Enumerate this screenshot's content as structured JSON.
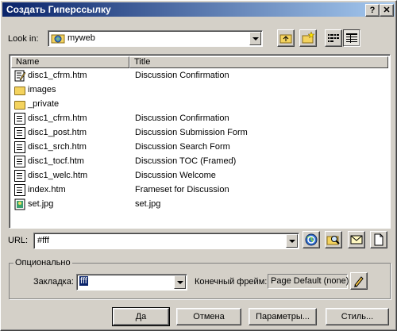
{
  "window": {
    "title": "Создать Гиперссылку",
    "help_btn": "?",
    "close_btn": "✕"
  },
  "lookin": {
    "label": "Look in:",
    "value": "myweb"
  },
  "columns": {
    "name": "Name",
    "title": "Title"
  },
  "files": [
    {
      "name": "disc1_cfrm.htm",
      "title": "Discussion Confirmation",
      "icon": "html-edit-icon"
    },
    {
      "name": "images",
      "title": "",
      "icon": "folder-icon"
    },
    {
      "name": "_private",
      "title": "",
      "icon": "folder-icon"
    },
    {
      "name": "disc1_cfrm.htm",
      "title": "Discussion Confirmation",
      "icon": "page-icon"
    },
    {
      "name": "disc1_post.htm",
      "title": "Discussion Submission Form",
      "icon": "page-icon"
    },
    {
      "name": "disc1_srch.htm",
      "title": "Discussion Search Form",
      "icon": "page-icon"
    },
    {
      "name": "disc1_tocf.htm",
      "title": "Discussion TOC (Framed)",
      "icon": "page-icon"
    },
    {
      "name": "disc1_welc.htm",
      "title": "Discussion Welcome",
      "icon": "page-icon"
    },
    {
      "name": "index.htm",
      "title": "Frameset for Discussion",
      "icon": "page-icon"
    },
    {
      "name": "set.jpg",
      "title": "set.jpg",
      "icon": "image-icon"
    }
  ],
  "url": {
    "label": "URL:",
    "value": "#fff"
  },
  "optional": {
    "label": "Опционально",
    "bookmark_label": "Закладка:",
    "bookmark_value": "fff",
    "target_label": "Конечный фрейм:",
    "target_value": "Page Default (none)"
  },
  "buttons": {
    "ok": "Да",
    "cancel": "Отмена",
    "params": "Параметры...",
    "style": "Стиль..."
  }
}
